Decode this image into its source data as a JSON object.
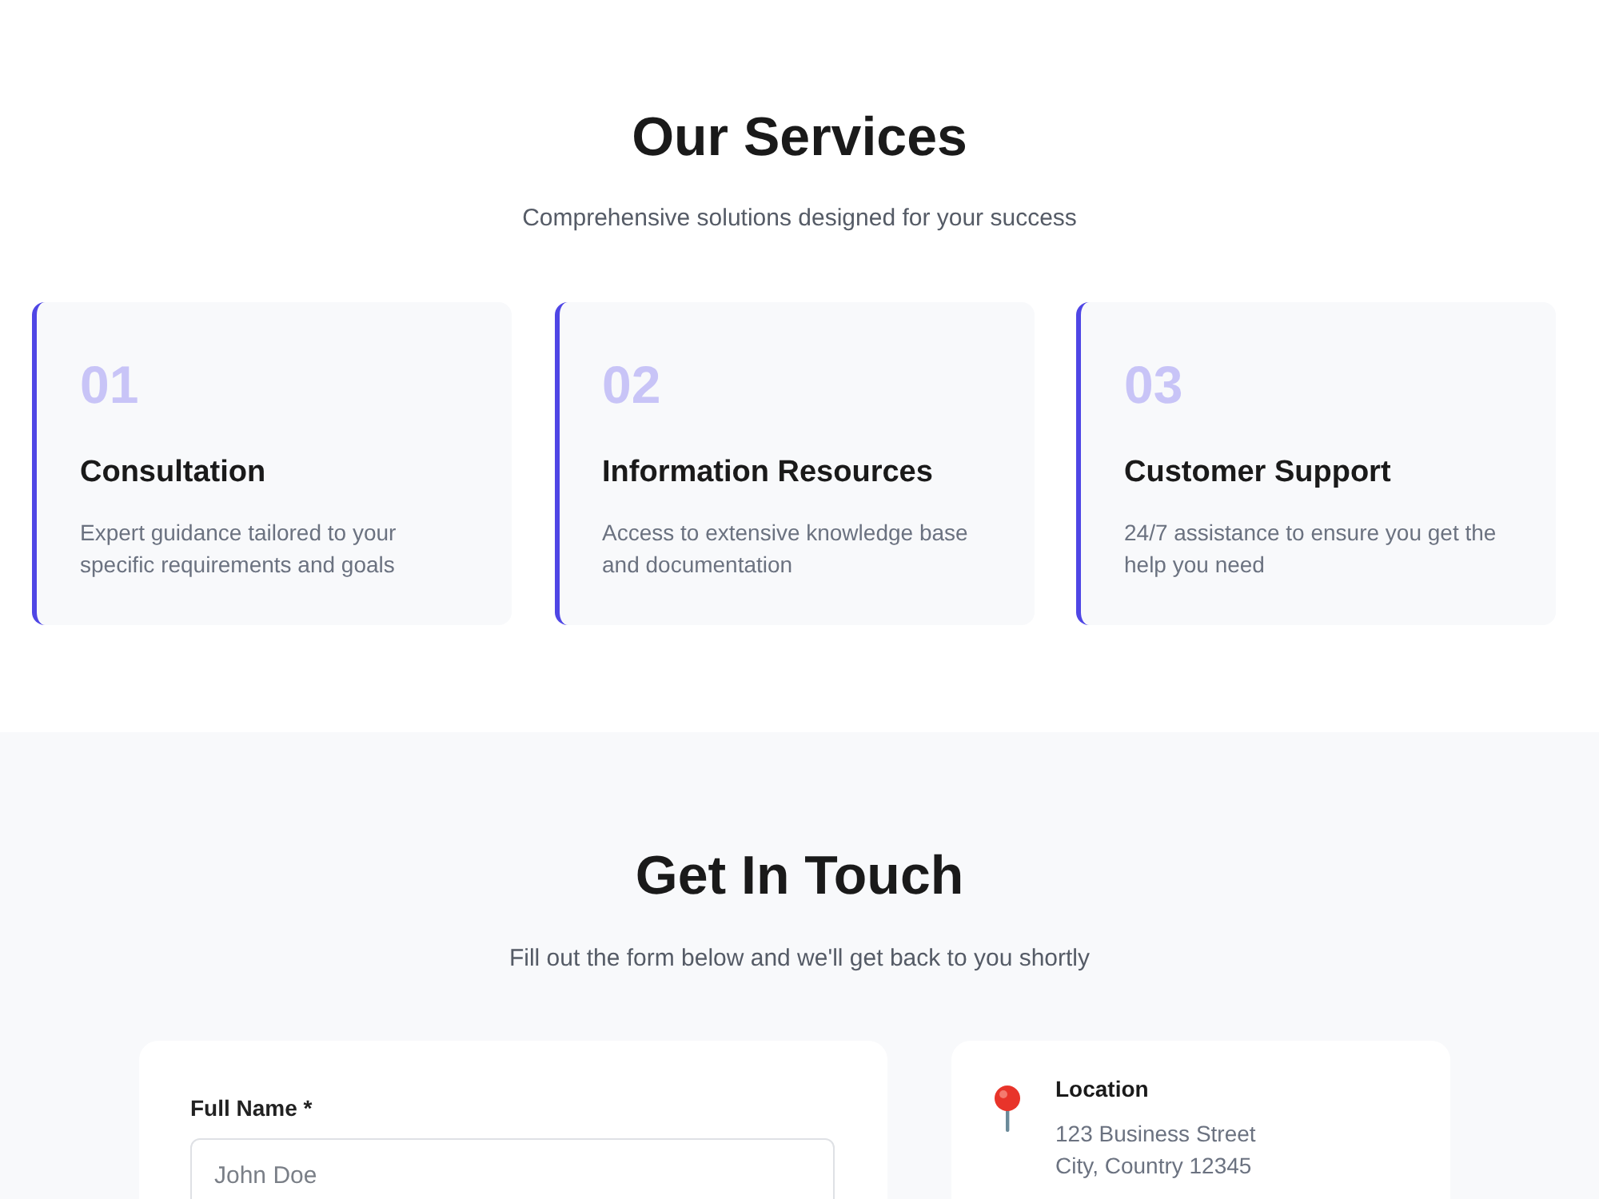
{
  "services": {
    "title": "Our Services",
    "subtitle": "Comprehensive solutions designed for your success",
    "cards": [
      {
        "number": "01",
        "title": "Consultation",
        "description": "Expert guidance tailored to your specific requirements and goals"
      },
      {
        "number": "02",
        "title": "Information Resources",
        "description": "Access to extensive knowledge base and documentation"
      },
      {
        "number": "03",
        "title": "Customer Support",
        "description": "24/7 assistance to ensure you get the help you need"
      }
    ]
  },
  "contact": {
    "title": "Get In Touch",
    "subtitle": "Fill out the form below and we'll get back to you shortly",
    "form": {
      "fields": [
        {
          "label": "Full Name *",
          "placeholder": "John Doe"
        }
      ]
    },
    "info": [
      {
        "title": "Location",
        "lines": [
          "123 Business Street",
          "City, Country 12345"
        ]
      }
    ]
  }
}
